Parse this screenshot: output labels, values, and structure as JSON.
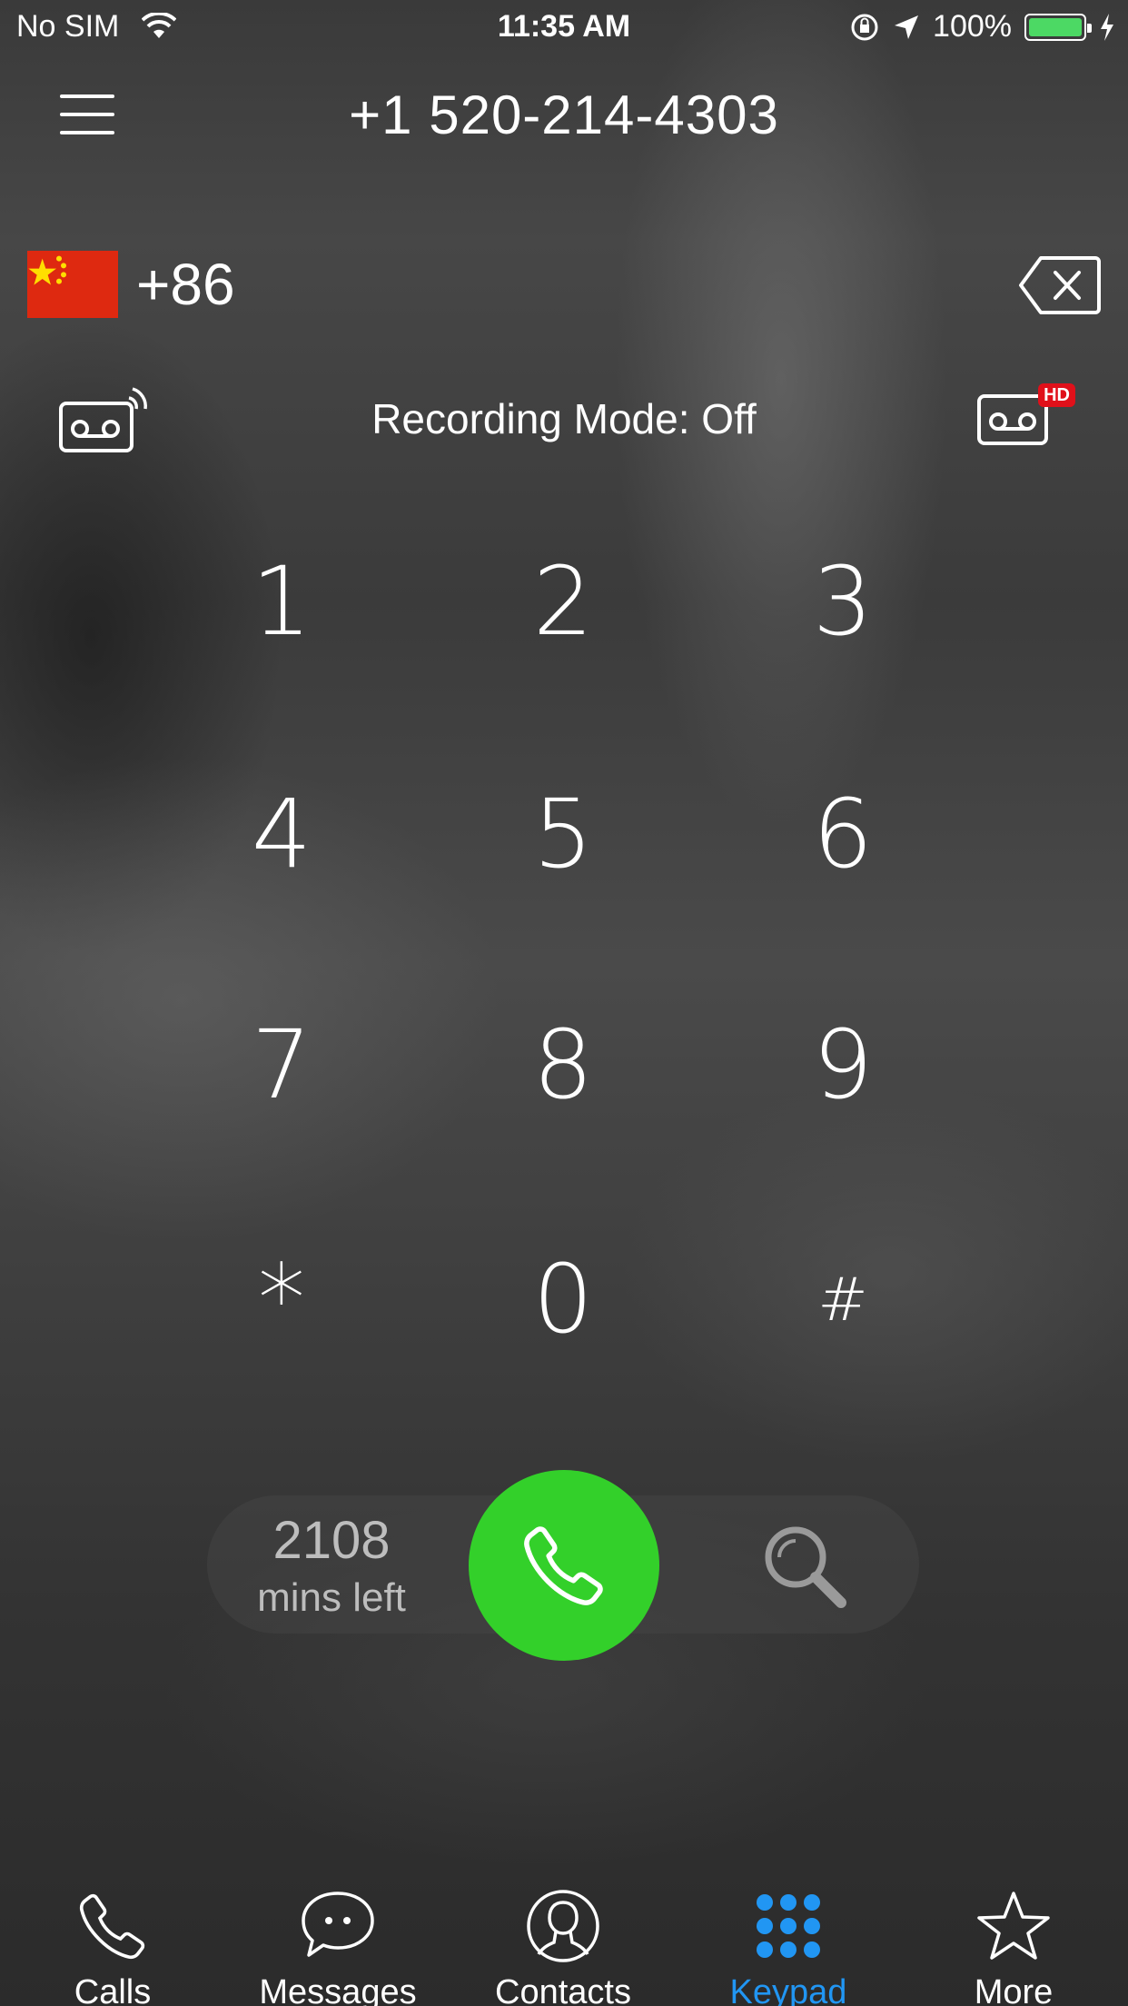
{
  "status_bar": {
    "carrier": "No SIM",
    "time": "11:35 AM",
    "battery_percent": "100%",
    "battery_level": 1.0,
    "battery_color": "#4cd964"
  },
  "header": {
    "phone_number": "+1 520-214-4303",
    "menu_icon": "hamburger-menu-icon"
  },
  "dialer": {
    "country_code": "+86",
    "country_flag": "china-flag",
    "backspace_icon": "backspace-icon"
  },
  "recording": {
    "mode_label": "Recording Mode: Off",
    "left_icon": "voicemail-wireless-icon",
    "right_icon": "voicemail-hd-icon",
    "hd_badge": "HD"
  },
  "keypad": {
    "keys": [
      "1",
      "2",
      "3",
      "4",
      "5",
      "6",
      "7",
      "8",
      "9",
      "*",
      "0",
      "#"
    ]
  },
  "actions": {
    "minutes_value": "2108",
    "minutes_label": "mins left",
    "call_icon": "phone-icon",
    "call_color": "#33d02a",
    "search_icon": "search-icon"
  },
  "tabs": [
    {
      "label": "Calls",
      "icon": "phone-icon"
    },
    {
      "label": "Messages",
      "icon": "chat-bubble-icon"
    },
    {
      "label": "Contacts",
      "icon": "person-icon"
    },
    {
      "label": "Keypad",
      "icon": "keypad-icon",
      "active": true
    },
    {
      "label": "More",
      "icon": "star-icon"
    }
  ],
  "accent_color": "#2196f3"
}
